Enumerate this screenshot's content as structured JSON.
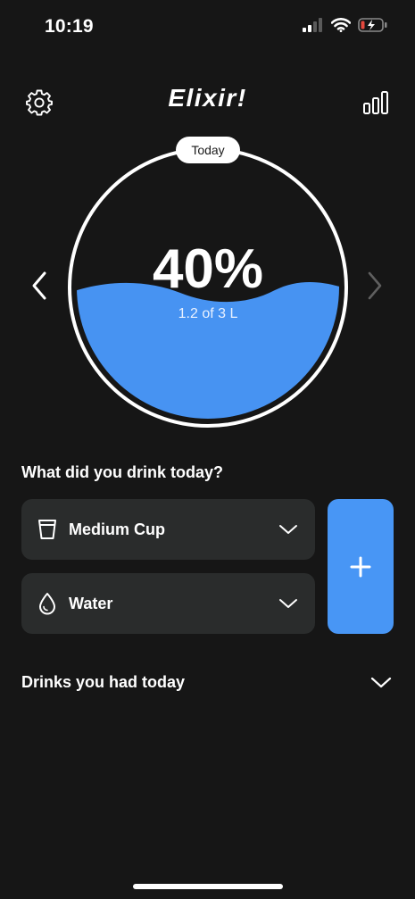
{
  "status_bar": {
    "time": "10:19",
    "battery_color": "#e5483d"
  },
  "header": {
    "title": "Elixir!",
    "settings_icon": "gear-icon",
    "stats_icon": "bar-chart-icon"
  },
  "gauge": {
    "period_label": "Today",
    "percent_label": "40%",
    "amount_label": "1.2 of 3 L",
    "fill_fraction": 0.4,
    "fill_color": "#4793f2"
  },
  "drink_form": {
    "question": "What did you drink today?",
    "size_select": {
      "value": "Medium Cup",
      "icon": "cup-icon"
    },
    "type_select": {
      "value": "Water",
      "icon": "water-drop-icon"
    },
    "add_button_label": "+",
    "accent_color": "#4896f5"
  },
  "history": {
    "title": "Drinks you had today"
  }
}
